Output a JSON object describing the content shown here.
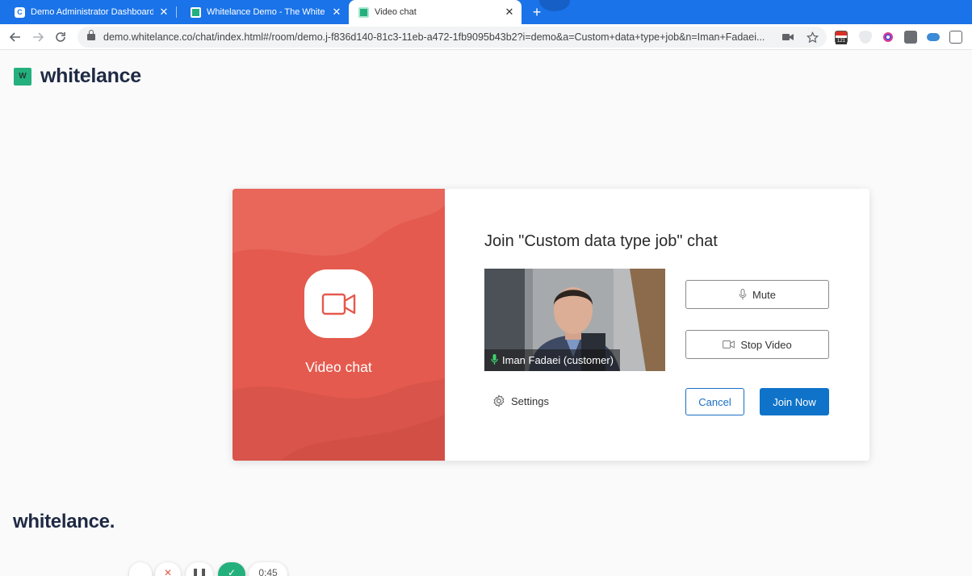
{
  "browser": {
    "tabs": [
      {
        "label": "Demo Administrator Dashboard",
        "favicon": "C",
        "active": false
      },
      {
        "label": "Whitelance Demo - The White La",
        "favicon": "w",
        "active": false
      },
      {
        "label": "Video chat",
        "favicon": "w",
        "active": true
      }
    ],
    "new_tab_symbol": "+",
    "close_symbol": "✕",
    "url": "demo.whitelance.co/chat/index.html#/room/demo.j-f836d140-81c3-11eb-a472-1fb9095b43b2?i=demo&a=Custom+data+type+job&n=Iman+Fadaei...",
    "calendar_badge": "121"
  },
  "header": {
    "logo_mark": "W",
    "logo_text": "whitelance"
  },
  "card": {
    "left_label": "Video chat",
    "title": "Join \"Custom data type job\" chat",
    "preview_name": "Iman Fadaei (customer)",
    "mute_label": "Mute",
    "stop_video_label": "Stop Video",
    "settings_label": "Settings",
    "cancel_label": "Cancel",
    "join_label": "Join Now"
  },
  "footer": {
    "logo_text": "whitelance."
  },
  "player": {
    "time": "0:45"
  },
  "colors": {
    "tab_strip": "#1a73e8",
    "card_left": "#e55a4e",
    "brand_green": "#23b07d",
    "primary_button": "#0f73c9"
  }
}
